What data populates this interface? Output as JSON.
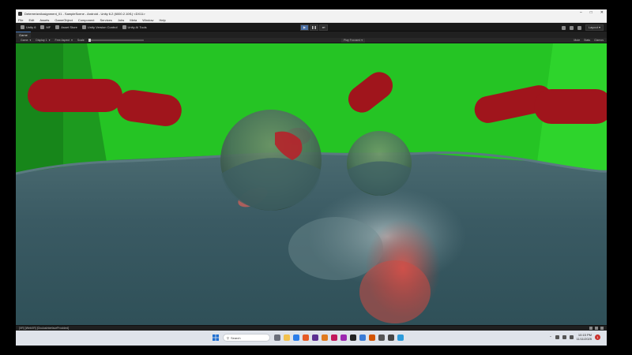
{
  "window": {
    "title": "DeterrerizeAssignment_01 - SampleScene - Android - Unity 6.2 (6000.2.10f1) <DX11>"
  },
  "menu": {
    "items": [
      "File",
      "Edit",
      "Assets",
      "GameObject",
      "Component",
      "Services",
      "Jobs",
      "Meta",
      "Window",
      "Help"
    ]
  },
  "toolbar": {
    "account": "Unity 6",
    "cloud": "MF",
    "asset_store": "Asset Store",
    "unity_version_control": "Unity Version Control",
    "unity_ai": "Unity AI Tools",
    "layout": "Layout"
  },
  "tabs": {
    "game": "Game"
  },
  "game_options": {
    "mode": "Game",
    "display": "Display 1",
    "aspect": "Free Aspect",
    "scale_label": "Scale",
    "play_focused": "Play Focused",
    "mute": "Mute",
    "stats": "Stats",
    "gizmos": "Gizmos"
  },
  "status": {
    "message": "[XR] [WebXR] [OculusInterfaceProvided]"
  },
  "taskbar": {
    "search_placeholder": "Search",
    "time": "10:15 PM",
    "date": "11/11/2025",
    "notifications": "1"
  },
  "colors": {
    "sky_green": "#22cc22",
    "capsule_red": "#a0151c",
    "water": "#3e5f66",
    "editor_dark": "#1b1b1b",
    "accent": "#4e7fbf"
  }
}
